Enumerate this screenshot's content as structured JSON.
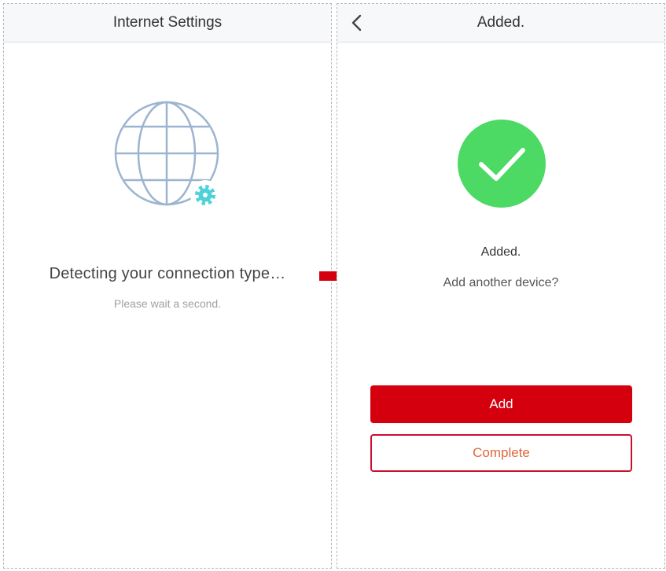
{
  "left_screen": {
    "title": "Internet Settings",
    "status": "Detecting your connection type…",
    "subtext": "Please wait a second.",
    "illustration_icon": "globe-with-gear-icon"
  },
  "right_screen": {
    "title": "Added.",
    "back_icon": "chevron-left-icon",
    "success_icon": "check-circle-icon",
    "message": "Added.",
    "question": "Add another device?",
    "add_button": "Add",
    "complete_button": "Complete"
  },
  "transition_arrow_icon": "arrow-right-icon",
  "colors": {
    "primary_red": "#d4000e",
    "success_green": "#4cd964",
    "globe_blue": "#9db4cf",
    "gear_teal": "#4fd1d9",
    "complete_text": "#e0663a"
  }
}
